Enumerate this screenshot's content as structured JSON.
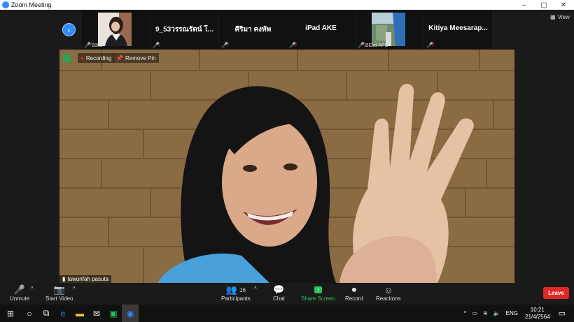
{
  "window": {
    "title": "Zoom Meeting"
  },
  "strip": {
    "view_label": "View",
    "tiles": [
      {
        "name": "",
        "label": "8899"
      },
      {
        "name": "9_53วรรณรัตน์ โ...",
        "label": ""
      },
      {
        "name": "ศิริมา คงทัพ",
        "label": ""
      },
      {
        "name": "iPad AKE",
        "label": ""
      },
      {
        "name": "",
        "label": "BEstt APS"
      },
      {
        "name": "Kitiya  Meesarap...",
        "label": ""
      }
    ]
  },
  "video": {
    "recording_label": "Recording",
    "remove_pin_label": "Remove Pin",
    "speaker_name": "tawunfah pasuta"
  },
  "toolbar": {
    "unmute": "Unmute",
    "start_video": "Start Video",
    "participants_count": "16",
    "participants": "Participants",
    "chat": "Chat",
    "share_screen": "Share Screen",
    "record": "Record",
    "reactions": "Reactions",
    "leave": "Leave"
  },
  "taskbar": {
    "lang": "ENG",
    "time": "10:21",
    "date": "21/4/2564"
  },
  "colors": {
    "accent": "#2d8cff",
    "share": "#27c25c",
    "leave": "#e02828"
  }
}
